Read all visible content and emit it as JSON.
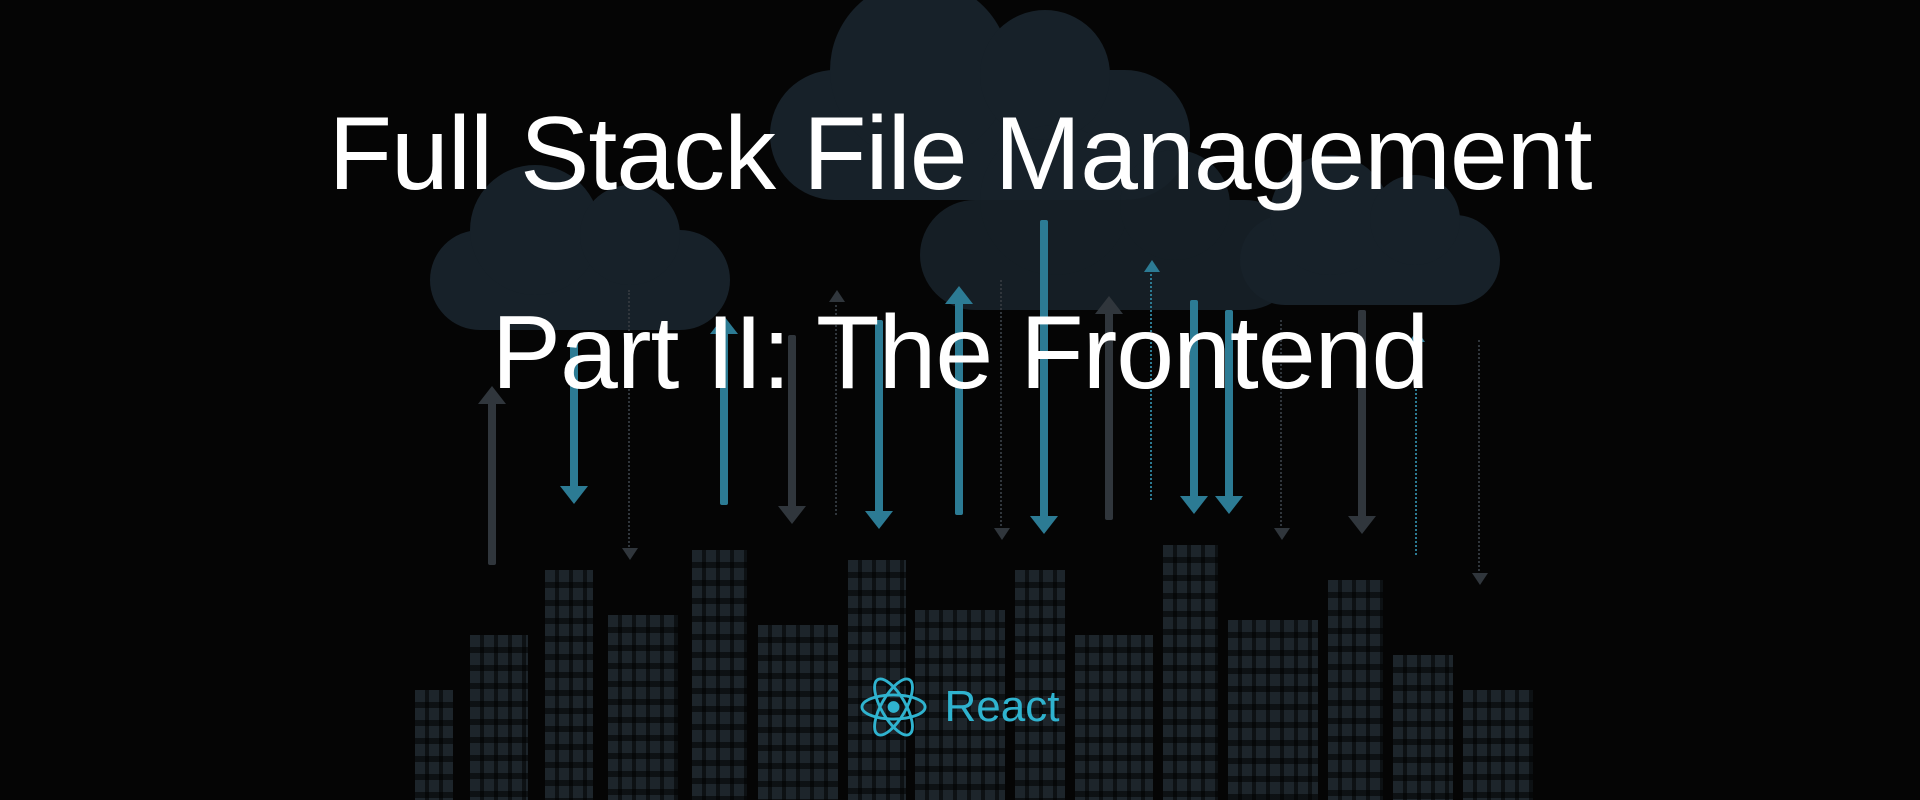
{
  "hero": {
    "title": "Full Stack File Management",
    "subtitle": "Part II: The Frontend"
  },
  "badge": {
    "label": "React",
    "icon_name": "react-logo-icon",
    "accent_color": "#2fb3cf"
  },
  "illustration": {
    "description": "Cloud computing skyline with upload and download arrows",
    "accent_color": "#2c7b94"
  }
}
